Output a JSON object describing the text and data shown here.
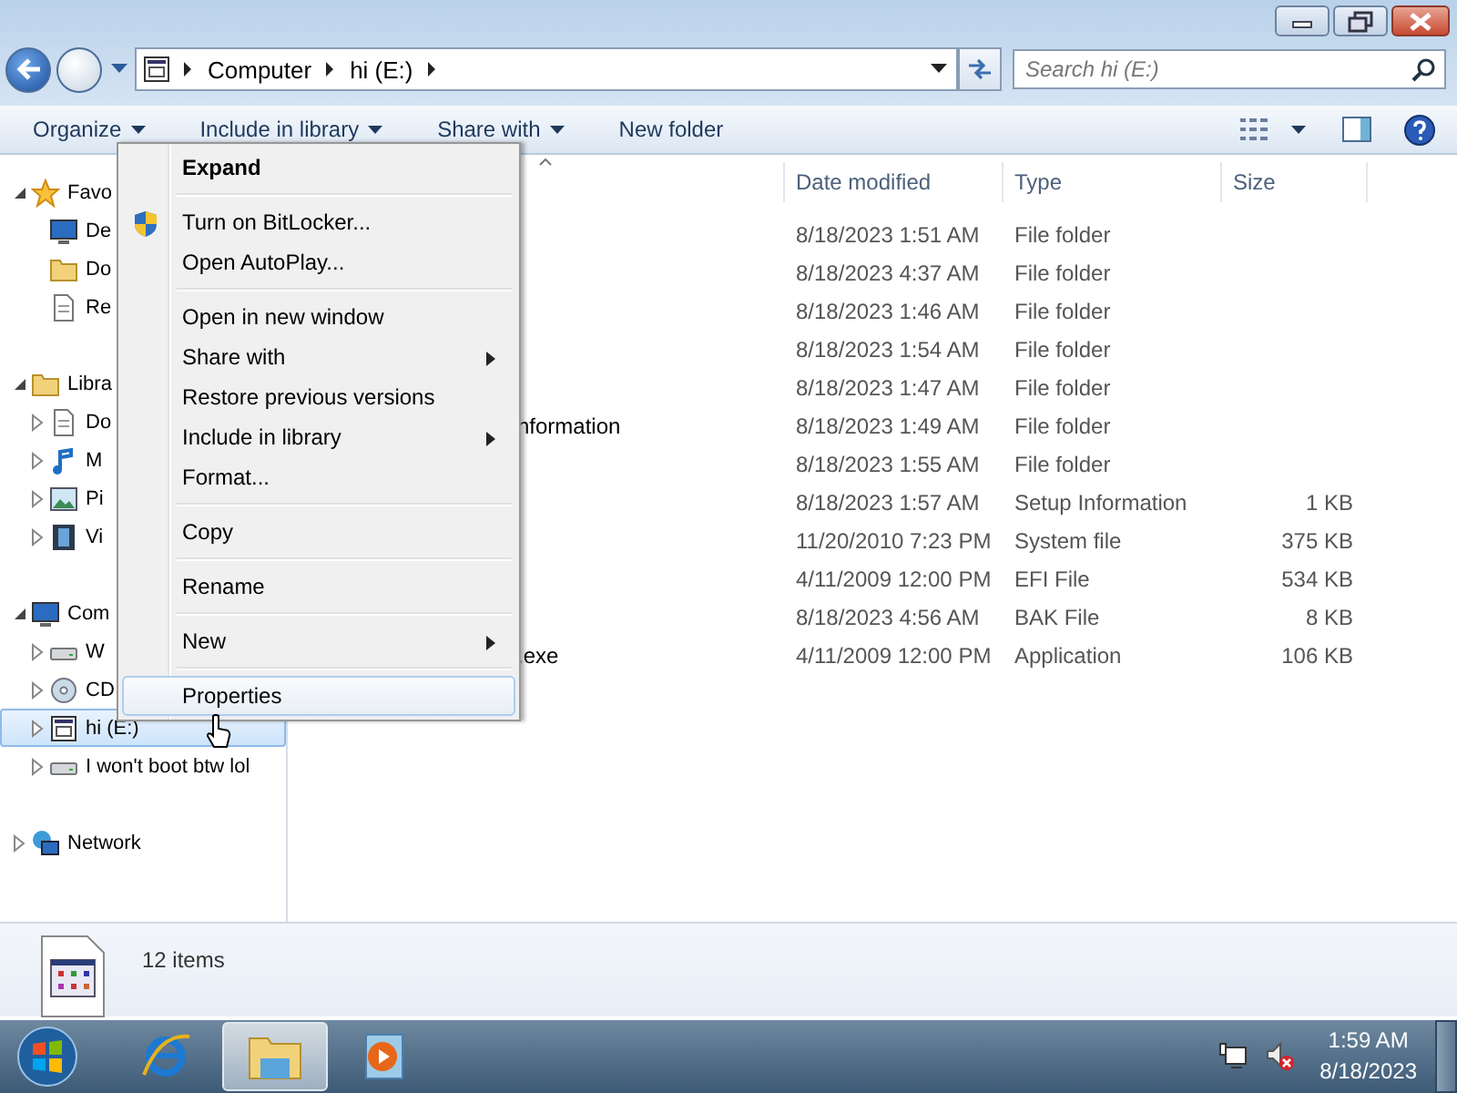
{
  "window": {
    "controls": [
      {
        "kind": "minimize"
      },
      {
        "kind": "restore"
      },
      {
        "kind": "close"
      }
    ]
  },
  "address_bar": {
    "crumbs": [
      "Computer",
      "hi (E:)"
    ]
  },
  "search": {
    "placeholder": "Search hi (E:)"
  },
  "toolbar": {
    "buttons": [
      {
        "label": "Organize",
        "dropdown": true
      },
      {
        "label": "Include in library",
        "dropdown": true
      },
      {
        "label": "Share with",
        "dropdown": true
      },
      {
        "label": "New folder",
        "dropdown": false
      }
    ]
  },
  "nav": [
    {
      "label": "Favo",
      "kind": "star",
      "expanded": true,
      "selected": false,
      "children": [
        {
          "label": "De",
          "kind": "monitor",
          "selected": false
        },
        {
          "label": "Do",
          "kind": "folder",
          "selected": false
        },
        {
          "label": "Re",
          "kind": "document",
          "selected": false
        }
      ]
    },
    {
      "label": "Libra",
      "kind": "folder",
      "expanded": true,
      "selected": false,
      "children": [
        {
          "label": "Do",
          "kind": "document",
          "expanded": false,
          "selected": false
        },
        {
          "label": "M",
          "kind": "note",
          "expanded": false,
          "selected": false
        },
        {
          "label": "Pi",
          "kind": "picture",
          "expanded": false,
          "selected": false
        },
        {
          "label": "Vi",
          "kind": "film",
          "expanded": false,
          "selected": false
        }
      ]
    },
    {
      "label": "Com",
      "kind": "monitor",
      "expanded": true,
      "selected": false,
      "children": [
        {
          "label": "W",
          "kind": "drive",
          "expanded": false,
          "selected": false
        },
        {
          "label": "CD",
          "kind": "disc",
          "expanded": false,
          "selected": false
        },
        {
          "label": "hi (E:)",
          "kind": "window",
          "expanded": false,
          "selected": true
        },
        {
          "label": "I won't boot btw lol",
          "kind": "drive",
          "expanded": false,
          "selected": false
        }
      ]
    },
    {
      "label": "Network",
      "kind": "globe",
      "expanded": false,
      "selected": false
    }
  ],
  "columns": [
    "Date modified",
    "Type",
    "Size"
  ],
  "files": [
    {
      "date": "8/18/2023 1:51 AM",
      "type": "File folder"
    },
    {
      "date": "8/18/2023 4:37 AM",
      "type": "File folder"
    },
    {
      "date": "8/18/2023 1:46 AM",
      "type": "File folder"
    },
    {
      "date": "8/18/2023 1:54 AM",
      "type": "File folder"
    },
    {
      "date": "8/18/2023 1:47 AM",
      "type": "File folder"
    },
    {
      "name": "nformation",
      "date": "8/18/2023 1:49 AM",
      "type": "File folder"
    },
    {
      "date": "8/18/2023 1:55 AM",
      "type": "File folder"
    },
    {
      "date": "8/18/2023 1:57 AM",
      "type": "Setup Information",
      "size": "1 KB"
    },
    {
      "date": "11/20/2010 7:23 PM",
      "type": "System file",
      "size": "375 KB"
    },
    {
      "date": "4/11/2009 12:00 PM",
      "type": "EFI File",
      "size": "534 KB"
    },
    {
      "date": "8/18/2023 4:56 AM",
      "type": "BAK File",
      "size": "8 KB"
    },
    {
      "name": ".exe",
      "date": "4/11/2009 12:00 PM",
      "type": "Application",
      "size": "106 KB"
    }
  ],
  "context_menu": {
    "groups": [
      [
        {
          "label": "Expand",
          "kind": "plain",
          "default": true,
          "submenu": false,
          "selected": false
        }
      ],
      [
        {
          "label": "Turn on BitLocker...",
          "kind": "shield",
          "default": false,
          "submenu": false,
          "selected": false
        },
        {
          "label": "Open AutoPlay...",
          "default": false,
          "submenu": false,
          "selected": false
        }
      ],
      [
        {
          "label": "Open in new window",
          "default": false,
          "submenu": false,
          "selected": false
        },
        {
          "label": "Share with",
          "default": false,
          "submenu": true,
          "selected": false
        },
        {
          "label": "Restore previous versions",
          "default": false,
          "submenu": false,
          "selected": false
        },
        {
          "label": "Include in library",
          "default": false,
          "submenu": true,
          "selected": false
        },
        {
          "label": "Format...",
          "default": false,
          "submenu": false,
          "selected": false
        }
      ],
      [
        {
          "label": "Copy",
          "default": false,
          "submenu": false,
          "selected": false
        }
      ],
      [
        {
          "label": "Rename",
          "default": false,
          "submenu": false,
          "selected": false
        }
      ],
      [
        {
          "label": "New",
          "default": false,
          "submenu": true,
          "selected": false
        }
      ],
      [
        {
          "label": "Properties",
          "default": false,
          "submenu": false,
          "selected": true
        }
      ]
    ]
  },
  "details": {
    "count": "12 items"
  },
  "taskbar": {
    "apps": [
      {
        "kind": "browser",
        "selected": false
      },
      {
        "kind": "explorer",
        "selected": true
      },
      {
        "kind": "player",
        "selected": false
      }
    ],
    "clock": {
      "time": "1:59 AM",
      "date": "8/18/2023"
    }
  }
}
